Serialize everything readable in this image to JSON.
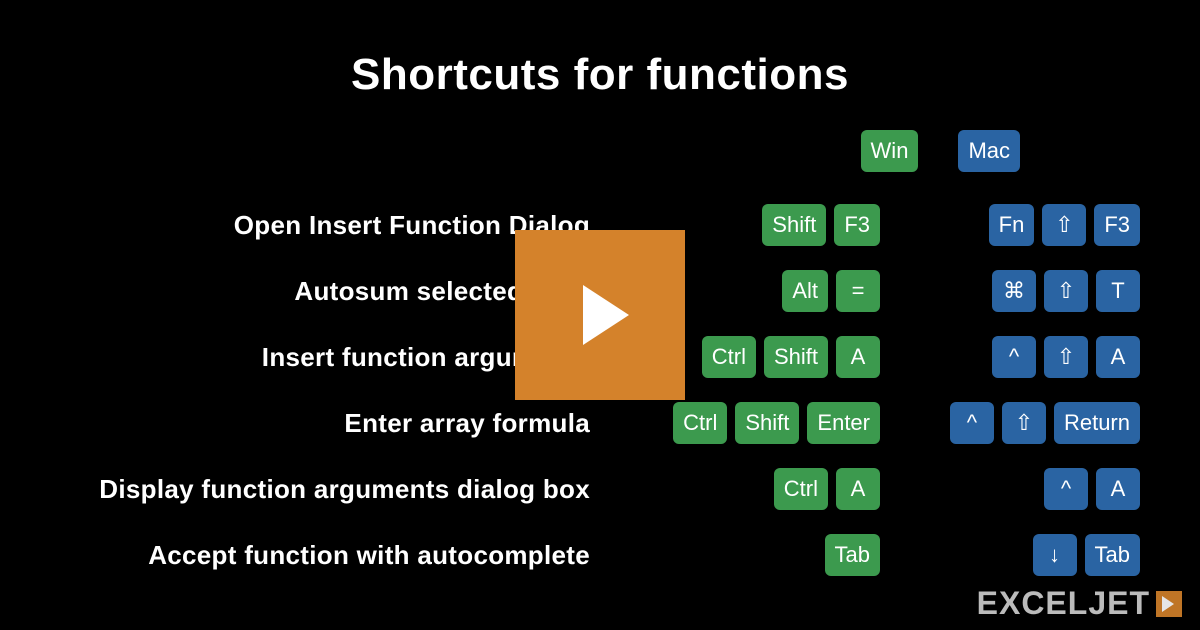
{
  "title": "Shortcuts for functions",
  "columns": {
    "win": "Win",
    "mac": "Mac"
  },
  "rows": [
    {
      "label": "Open Insert Function Dialog",
      "win": [
        "Shift",
        "F3"
      ],
      "mac": [
        "Fn",
        "⇧",
        "F3"
      ]
    },
    {
      "label": "Autosum selected cells",
      "win": [
        "Alt",
        "="
      ],
      "mac": [
        "⌘",
        "⇧",
        "T"
      ]
    },
    {
      "label": "Insert function arguments",
      "win": [
        "Ctrl",
        "Shift",
        "A"
      ],
      "mac": [
        "^",
        "⇧",
        "A"
      ]
    },
    {
      "label": "Enter array formula",
      "win": [
        "Ctrl",
        "Shift",
        "Enter"
      ],
      "mac": [
        "^",
        "⇧",
        "Return"
      ]
    },
    {
      "label": "Display function arguments dialog box",
      "win": [
        "Ctrl",
        "A"
      ],
      "mac": [
        "^",
        "A"
      ]
    },
    {
      "label": "Accept function with autocomplete",
      "win": [
        "Tab"
      ],
      "mac": [
        "↓",
        "Tab"
      ]
    }
  ],
  "logo": "EXCELJET"
}
